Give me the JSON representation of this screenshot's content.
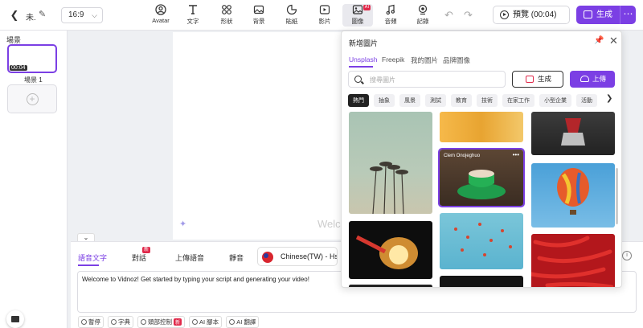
{
  "header": {
    "project_name": "未.",
    "ratio": "16:9",
    "tools": [
      {
        "label": "Avatar",
        "icon": "avatar-icon"
      },
      {
        "label": "文字",
        "icon": "text-icon"
      },
      {
        "label": "形狀",
        "icon": "shapes-icon"
      },
      {
        "label": "背景",
        "icon": "background-icon"
      },
      {
        "label": "貼紙",
        "icon": "sticker-icon"
      },
      {
        "label": "影片",
        "icon": "video-icon"
      },
      {
        "label": "圖像",
        "icon": "image-icon",
        "badge": "AI"
      },
      {
        "label": "音頻",
        "icon": "music-icon"
      },
      {
        "label": "記錄",
        "icon": "record-icon"
      }
    ],
    "preview_label": "預覽 (00:04)",
    "generate_label": "生成"
  },
  "sidebar": {
    "title": "場景",
    "scene_time": "00:04",
    "scene_label": "場景 1"
  },
  "canvas": {
    "text": "Welco"
  },
  "script": {
    "tabs": [
      "語音文字",
      "對話",
      "上傳語音",
      "靜音"
    ],
    "new_badge": "新",
    "voice": "Chinese(TW) - HsiaoYu",
    "content": "Welcome to Vidnoz! Get started by typing your script and generating your video!",
    "tools": [
      "暫停",
      "字典",
      "頭部控制",
      "AI 腳本",
      "AI 翻譯"
    ]
  },
  "image_panel": {
    "title": "新增圖片",
    "tabs": [
      "Unsplash",
      "Freepik",
      "我的圖片",
      "品牌圖像"
    ],
    "search_placeholder": "搜尋圖片",
    "generate_label": "生成",
    "upload_label": "上傳",
    "chips": [
      "熱門",
      "抽象",
      "風景",
      "測試",
      "教育",
      "技術",
      "在家工作",
      "小型企業",
      "活動"
    ],
    "selected_credit": "Clem Onojeghuo"
  },
  "colors": {
    "accent": "#7b3fe4",
    "badge": "#e0294a"
  }
}
